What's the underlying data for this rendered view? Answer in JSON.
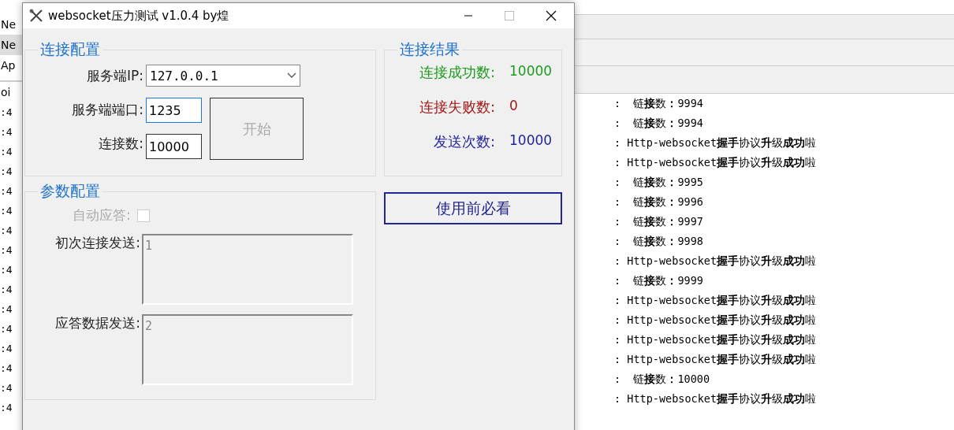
{
  "background_window": {
    "left_fragments": [
      "Ne",
      "Ne",
      "Ap",
      "oi"
    ],
    "log": [
      {
        "prefix": ":4",
        "message": ":  链**接**数**：**9994"
      },
      {
        "prefix": ":4",
        "message": ":  链**接**数**：**9994"
      },
      {
        "prefix": ":4",
        "message": ": Http-websocket**握手**协议**升**级**成功**啦"
      },
      {
        "prefix": ":4",
        "message": ": Http-websocket**握手**协议**升**级**成功**啦"
      },
      {
        "prefix": ":4",
        "message": ":  链**接**数**：**9995"
      },
      {
        "prefix": ":4",
        "message": ":  链**接**数**：**9996"
      },
      {
        "prefix": ":4",
        "message": ":  链**接**数**：**9997"
      },
      {
        "prefix": ":4",
        "message": ":  链**接**数**：**9998"
      },
      {
        "prefix": ":4",
        "message": ": Http-websocket**握手**协议**升**级**成功**啦"
      },
      {
        "prefix": ":4",
        "message": ":  链**接**数**：**9999"
      },
      {
        "prefix": ":4",
        "message": ": Http-websocket**握手**协议**升**级**成功**啦"
      },
      {
        "prefix": ":4",
        "message": ": Http-websocket**握手**协议**升**级**成功**啦"
      },
      {
        "prefix": ":4",
        "message": ": Http-websocket**握手**协议**升**级**成功**啦"
      },
      {
        "prefix": ":4",
        "message": ": Http-websocket**握手**协议**升**级**成功**啦"
      },
      {
        "prefix": ":4",
        "message": ":  链**接**数**：**10000"
      },
      {
        "prefix": ":4",
        "message": ": Http-websocket**握手**协议**升**级**成功**啦"
      }
    ]
  },
  "window": {
    "title": "websocket压力测试 v1.0.4 by煌"
  },
  "connection_config": {
    "title": "连接配置",
    "server_ip": {
      "label": "服务端IP:",
      "value": "127.0.0.1"
    },
    "server_port": {
      "label": "服务端端口:",
      "value": "1235",
      "focused": true
    },
    "connections": {
      "label": "连接数:",
      "value": "10000",
      "focused": false
    },
    "start_button": {
      "label": "开始",
      "disabled": true
    }
  },
  "connection_results": {
    "title": "连接结果",
    "rows": [
      {
        "label": "连接成功数:",
        "value": "10000",
        "color": "#1e9a1e"
      },
      {
        "label": "连接失败数:",
        "value": "0",
        "color": "#a01818"
      },
      {
        "label": "发送次数:",
        "value": "10000",
        "color": "#1f1f9a"
      }
    ]
  },
  "readme_button": {
    "label": "使用前必看"
  },
  "parameter_config": {
    "title": "参数配置",
    "auto_reply": {
      "label": "自动应答:",
      "checked": false,
      "disabled": true
    },
    "initial_send": {
      "label": "初次连接发送:",
      "value": "1"
    },
    "reply_send": {
      "label": "应答数据发送:",
      "value": "2"
    }
  }
}
